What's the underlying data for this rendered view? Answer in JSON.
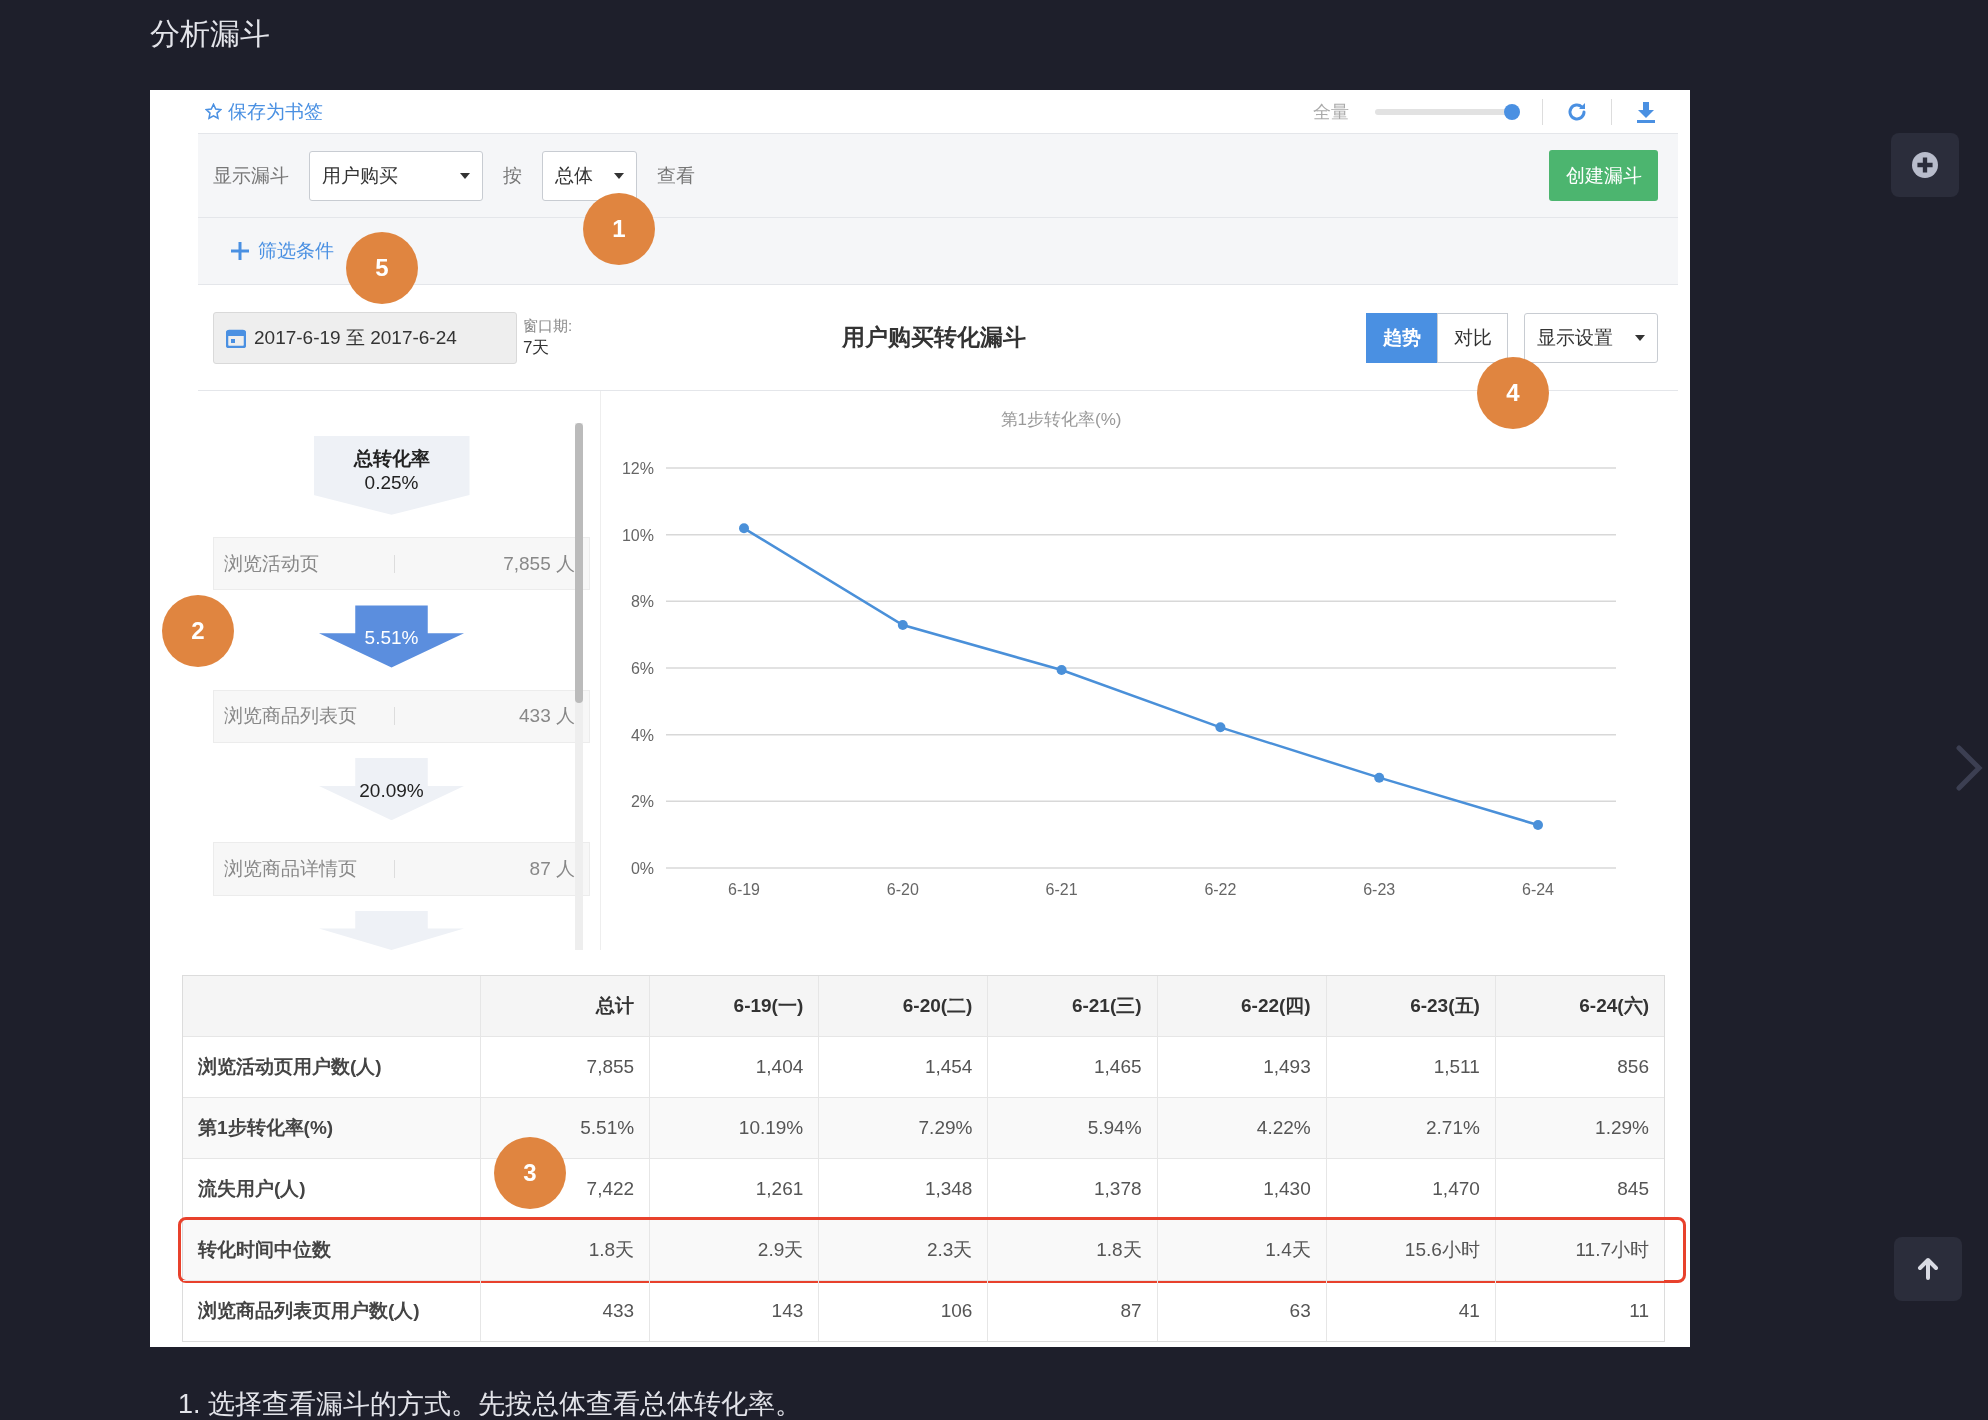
{
  "heading": "分析漏斗",
  "toolbar": {
    "bookmark": "保存为书签",
    "scale_label": "全量",
    "scale": {
      "level": 1
    }
  },
  "controls": {
    "funnel_label": "显示漏斗",
    "funnel_select": "用户购买",
    "by_label": "按",
    "group_select": "总体",
    "view_label": "查看",
    "create_button": "创建漏斗"
  },
  "filter": {
    "add_filter": "筛选条件"
  },
  "header": {
    "date_range": "2017-6-19 至 2017-6-24",
    "window_label": "窗口期:",
    "window_value": "7天",
    "title": "用户购买转化漏斗",
    "display_settings": "显示设置",
    "view_tabs": [
      {
        "label": "趋势",
        "selected": true
      },
      {
        "label": "对比",
        "selected": false
      }
    ]
  },
  "funnel": {
    "total_label": "总转化率",
    "total_value": "0.25%",
    "steps": [
      {
        "name": "浏览活动页",
        "count": "7,855 人"
      },
      {
        "name": "浏览商品列表页",
        "count": "433 人"
      },
      {
        "name": "浏览商品详情页",
        "count": "87 人"
      }
    ],
    "arrows": [
      {
        "rate": "5.51%",
        "selected": true
      },
      {
        "rate": "20.09%",
        "selected": false
      },
      {
        "selected": false
      }
    ]
  },
  "chart_data": {
    "type": "line",
    "title": "第1步转化率(%)",
    "categories": [
      "6-19",
      "6-20",
      "6-21",
      "6-22",
      "6-23",
      "6-24"
    ],
    "grid": true,
    "series": [
      {
        "color": "#4a90d9",
        "marker": "circle",
        "values": [
          10.19,
          7.29,
          5.94,
          4.22,
          2.71,
          1.29
        ]
      }
    ],
    "ylim": [
      0,
      12
    ],
    "yticks": [
      {
        "value": 0,
        "label": "0%"
      },
      {
        "value": 2,
        "label": "2%"
      },
      {
        "value": 4,
        "label": "4%"
      },
      {
        "value": 6,
        "label": "6%"
      },
      {
        "value": 8,
        "label": "8%"
      },
      {
        "value": 10,
        "label": "10%"
      },
      {
        "value": 12,
        "label": "12%"
      }
    ]
  },
  "table": {
    "columns": [
      "总计",
      "6-19(一)",
      "6-20(二)",
      "6-21(三)",
      "6-22(四)",
      "6-23(五)",
      "6-24(六)"
    ],
    "rows": [
      {
        "label": "浏览活动页用户数(人)",
        "highlighted": false,
        "cells": [
          "7,855",
          "1,404",
          "1,454",
          "1,465",
          "1,493",
          "1,511",
          "856"
        ]
      },
      {
        "label": "第1步转化率(%)",
        "highlighted": false,
        "cells": [
          "5.51%",
          "10.19%",
          "7.29%",
          "5.94%",
          "4.22%",
          "2.71%",
          "1.29%"
        ]
      },
      {
        "label": "流失用户(人)",
        "highlighted": false,
        "cells": [
          "7,422",
          "1,261",
          "1,348",
          "1,378",
          "1,430",
          "1,470",
          "845"
        ]
      },
      {
        "label": "转化时间中位数",
        "highlighted": true,
        "cells": [
          "1.8天",
          "2.9天",
          "2.3天",
          "1.8天",
          "1.4天",
          "15.6小时",
          "11.7小时"
        ]
      },
      {
        "label": "浏览商品列表页用户数(人)",
        "highlighted": false,
        "cells": [
          "433",
          "143",
          "106",
          "87",
          "63",
          "41",
          "11"
        ]
      }
    ]
  },
  "markers": [
    {
      "label": "1"
    },
    {
      "label": "5"
    },
    {
      "label": "4"
    },
    {
      "label": "2"
    },
    {
      "label": "3"
    }
  ],
  "footer_text": "1. 选择查看漏斗的方式。先按总体查看总体转化率。"
}
